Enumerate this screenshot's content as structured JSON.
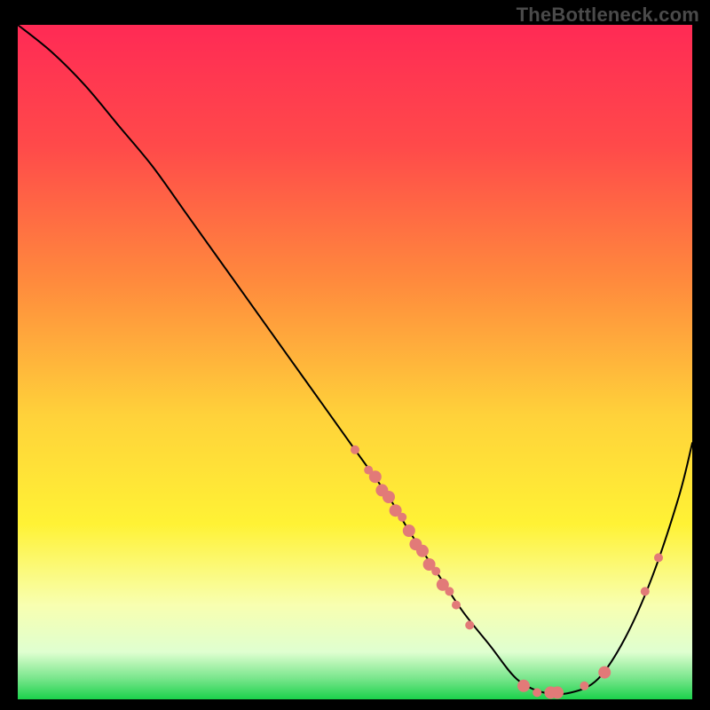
{
  "attribution": "TheBottleneck.com",
  "colors": {
    "curve": "#000000",
    "curve_width": 2,
    "dot_fill": "#e27a78",
    "dot_radius_small": 5,
    "dot_radius_large": 7,
    "gradient_stops": [
      {
        "offset": 0.0,
        "color": "#ff2a55"
      },
      {
        "offset": 0.18,
        "color": "#ff4a4a"
      },
      {
        "offset": 0.38,
        "color": "#ff8a3d"
      },
      {
        "offset": 0.58,
        "color": "#ffd23a"
      },
      {
        "offset": 0.74,
        "color": "#fff235"
      },
      {
        "offset": 0.86,
        "color": "#f8ffb0"
      },
      {
        "offset": 0.93,
        "color": "#dfffd0"
      },
      {
        "offset": 0.97,
        "color": "#76e58a"
      },
      {
        "offset": 1.0,
        "color": "#1bd24b"
      }
    ]
  },
  "chart_data": {
    "type": "line",
    "title": "",
    "xlabel": "",
    "ylabel": "",
    "xlim": [
      0,
      100
    ],
    "ylim": [
      0,
      100
    ],
    "grid": false,
    "legend": false,
    "series": [
      {
        "name": "bottleneck-curve",
        "x": [
          0,
          5,
          10,
          15,
          20,
          25,
          30,
          35,
          40,
          45,
          50,
          55,
          58,
          62,
          66,
          70,
          74,
          78,
          82,
          86,
          90,
          94,
          98,
          100
        ],
        "y": [
          100,
          96,
          91,
          85,
          79,
          72,
          65,
          58,
          51,
          44,
          37,
          30,
          25,
          19,
          13,
          8,
          3,
          1,
          1,
          3,
          9,
          18,
          30,
          38
        ]
      }
    ],
    "markers": [
      {
        "x": 50,
        "y": 37,
        "r": "small"
      },
      {
        "x": 52,
        "y": 34,
        "r": "small"
      },
      {
        "x": 53,
        "y": 33,
        "r": "large"
      },
      {
        "x": 54,
        "y": 31,
        "r": "large"
      },
      {
        "x": 55,
        "y": 30,
        "r": "large"
      },
      {
        "x": 56,
        "y": 28,
        "r": "large"
      },
      {
        "x": 57,
        "y": 27,
        "r": "small"
      },
      {
        "x": 58,
        "y": 25,
        "r": "large"
      },
      {
        "x": 59,
        "y": 23,
        "r": "large"
      },
      {
        "x": 60,
        "y": 22,
        "r": "large"
      },
      {
        "x": 61,
        "y": 20,
        "r": "large"
      },
      {
        "x": 62,
        "y": 19,
        "r": "small"
      },
      {
        "x": 63,
        "y": 17,
        "r": "large"
      },
      {
        "x": 64,
        "y": 16,
        "r": "small"
      },
      {
        "x": 65,
        "y": 14,
        "r": "small"
      },
      {
        "x": 67,
        "y": 11,
        "r": "small"
      },
      {
        "x": 75,
        "y": 2,
        "r": "large"
      },
      {
        "x": 77,
        "y": 1,
        "r": "small"
      },
      {
        "x": 79,
        "y": 1,
        "r": "large"
      },
      {
        "x": 80,
        "y": 1,
        "r": "large"
      },
      {
        "x": 84,
        "y": 2,
        "r": "small"
      },
      {
        "x": 87,
        "y": 4,
        "r": "large"
      },
      {
        "x": 93,
        "y": 16,
        "r": "small"
      },
      {
        "x": 95,
        "y": 21,
        "r": "small"
      }
    ]
  }
}
